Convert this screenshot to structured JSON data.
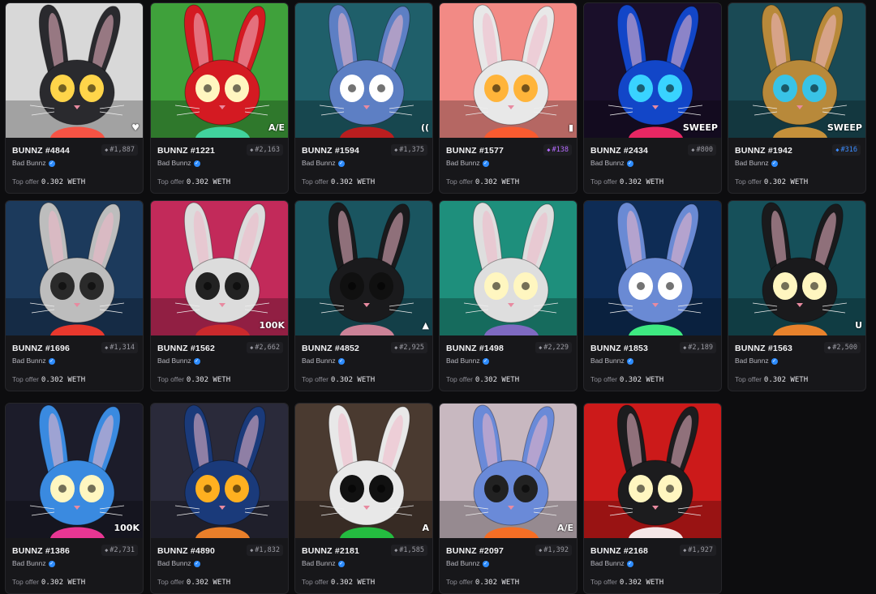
{
  "collection": "Bad Bunnz",
  "offer_label": "Top offer",
  "offer_value": "0.302 WETH",
  "cards": [
    {
      "title": "BUNNZ #4844",
      "rank": "#1,887",
      "bg": "#d8d8d8",
      "fur": "#2a2a2e",
      "eye": "#ffd54a",
      "corner": "♥",
      "accent": "#ff4a3a"
    },
    {
      "title": "BUNNZ #1221",
      "rank": "#2,163",
      "bg": "#3fa13b",
      "fur": "#d41a22",
      "eye": "#fff6c0",
      "corner": "A/E",
      "accent": "#44ddaa"
    },
    {
      "title": "BUNNZ #1594",
      "rank": "#1,375",
      "bg": "#1f5f6a",
      "fur": "#5d7fc4",
      "eye": "#ffffff",
      "corner": "((",
      "accent": "#cc1a1a"
    },
    {
      "title": "BUNNZ #1577",
      "rank": "#138",
      "rank_style": "purple",
      "bg": "#f28a85",
      "fur": "#e8e8e8",
      "eye": "#ffb43a",
      "corner": "▮",
      "accent": "#ff5a2a"
    },
    {
      "title": "BUNNZ #2434",
      "rank": "#800",
      "bg": "#1a0f2a",
      "fur": "#1246c8",
      "eye": "#39d3ff",
      "corner": "SWEEP",
      "accent": "#ff2a6a"
    },
    {
      "title": "BUNNZ #1942",
      "rank": "#316",
      "rank_style": "blue",
      "bg": "#1a4a55",
      "fur": "#b8893a",
      "eye": "#39c3e6",
      "corner": "SWEEP",
      "accent": "#d99a3a"
    },
    {
      "title": "BUNNZ #1696",
      "rank": "#1,314",
      "bg": "#1c3a5c",
      "fur": "#bdbdbd",
      "eye": "#2a2a2a",
      "corner": "",
      "accent": "#ff3a2a"
    },
    {
      "title": "BUNNZ #1562",
      "rank": "#2,662",
      "bg": "#c22a5a",
      "fur": "#dcdcdc",
      "eye": "#222",
      "corner": "100K",
      "accent": "#d02a2a"
    },
    {
      "title": "BUNNZ #4852",
      "rank": "#2,925",
      "bg": "#1a5560",
      "fur": "#1a1a1c",
      "eye": "#101010",
      "corner": "▲",
      "accent": "#e08aa0"
    },
    {
      "title": "BUNNZ #1498",
      "rank": "#2,229",
      "bg": "#1e8f7c",
      "fur": "#dedede",
      "eye": "#fff6c0",
      "corner": "",
      "accent": "#8a6acc"
    },
    {
      "title": "BUNNZ #1853",
      "rank": "#2,189",
      "bg": "#0e2c55",
      "fur": "#6a8ad4",
      "eye": "#ffffff",
      "corner": "",
      "accent": "#44ff88"
    },
    {
      "title": "BUNNZ #1563",
      "rank": "#2,500",
      "bg": "#16505a",
      "fur": "#1a1a1c",
      "eye": "#fff6c0",
      "corner": "U",
      "accent": "#ff8a2a"
    },
    {
      "title": "BUNNZ #1386",
      "rank": "#2,731",
      "bg": "#1c1c2a",
      "fur": "#3a8ae0",
      "eye": "#fff6c0",
      "corner": "100K",
      "accent": "#ff3aa0"
    },
    {
      "title": "BUNNZ #4890",
      "rank": "#1,832",
      "bg": "#2a2a3a",
      "fur": "#1a3a7a",
      "eye": "#ffb020",
      "corner": "",
      "accent": "#ff8a2a"
    },
    {
      "title": "BUNNZ #2181",
      "rank": "#1,585",
      "bg": "#4a3a30",
      "fur": "#e8e8e8",
      "eye": "#111",
      "corner": "A",
      "accent": "#22cc44"
    },
    {
      "title": "BUNNZ #2097",
      "rank": "#1,392",
      "bg": "#c8b8c0",
      "fur": "#6a8ad8",
      "eye": "#222",
      "corner": "A/E",
      "accent": "#ff6a1a"
    },
    {
      "title": "BUNNZ #2168",
      "rank": "#1,927",
      "bg": "#cc1a1a",
      "fur": "#1c1c1e",
      "eye": "#fff6c0",
      "corner": "",
      "accent": "#ffffff"
    }
  ]
}
